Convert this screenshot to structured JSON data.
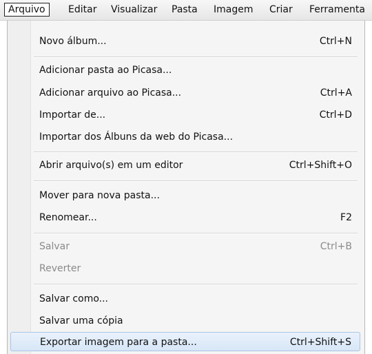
{
  "menubar": {
    "items": [
      "Arquivo",
      "Editar",
      "Visualizar",
      "Pasta",
      "Imagem",
      "Criar",
      "Ferramenta"
    ]
  },
  "menu": {
    "items": [
      {
        "label": "Novo álbum...",
        "shortcut": "Ctrl+N"
      },
      {
        "label": "Adicionar pasta ao Picasa...",
        "shortcut": ""
      },
      {
        "label": "Adicionar arquivo ao Picasa...",
        "shortcut": "Ctrl+A"
      },
      {
        "label": "Importar de...",
        "shortcut": "Ctrl+D"
      },
      {
        "label": "Importar dos Álbuns da web do Picasa...",
        "shortcut": ""
      },
      {
        "label": "Abrir arquivo(s) em um editor",
        "shortcut": "Ctrl+Shift+O"
      },
      {
        "label": "Mover para nova pasta...",
        "shortcut": ""
      },
      {
        "label": "Renomear...",
        "shortcut": "F2"
      },
      {
        "label": "Salvar",
        "shortcut": "Ctrl+B"
      },
      {
        "label": "Reverter",
        "shortcut": ""
      },
      {
        "label": "Salvar como...",
        "shortcut": ""
      },
      {
        "label": "Salvar uma cópia",
        "shortcut": ""
      },
      {
        "label": "Exportar imagem para a pasta...",
        "shortcut": "Ctrl+Shift+S"
      }
    ]
  },
  "colors": {
    "highlight": "#d7e6f7",
    "disabled_text": "#8a8a8a"
  }
}
